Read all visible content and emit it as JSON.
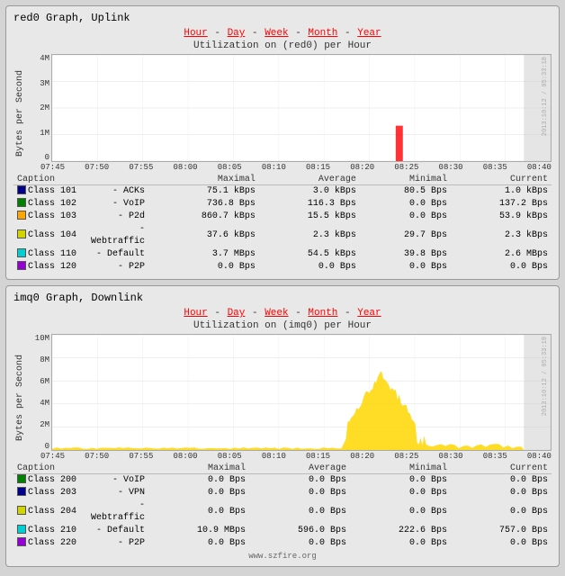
{
  "panels": [
    {
      "id": "uplink",
      "title": "red0 Graph, Uplink",
      "subtitle": "Utilization on (red0) per Hour",
      "navLinks": [
        "Hour",
        "Day",
        "Week",
        "Month",
        "Year"
      ],
      "yAxisLabel": "Bytes per Second",
      "yTicks": [
        "4M",
        "3M",
        "2M",
        "1M",
        "0"
      ],
      "xLabels": [
        "07:45",
        "07:50",
        "07:55",
        "08:00",
        "08:05",
        "08:10",
        "08:15",
        "08:20",
        "08:25",
        "08:30",
        "08:35",
        "08:40"
      ],
      "watermark": "2013:10:12 / 05:33:18",
      "peakX": 72,
      "peakColor": "red",
      "peakHeight": 40,
      "rightBarColor": "#ccc",
      "legend": {
        "headers": [
          "Caption",
          "",
          "Maximal",
          "Average",
          "Minimal",
          "Current"
        ],
        "rows": [
          {
            "color": "#00008b",
            "class": "Class 101",
            "name": "ACKs",
            "maximal": "75.1 kBps",
            "average": "3.0 kBps",
            "minimal": "80.5  Bps",
            "current": "1.0  kBps"
          },
          {
            "color": "#008000",
            "class": "Class 102",
            "name": "VoIP",
            "maximal": "736.8  Bps",
            "average": "116.3  Bps",
            "minimal": "0.0  Bps",
            "current": "137.2  Bps"
          },
          {
            "color": "#ffa500",
            "class": "Class 103",
            "name": "P2d",
            "maximal": "860.7 kBps",
            "average": "15.5 kBps",
            "minimal": "0.0  Bps",
            "current": "53.9 kBps"
          },
          {
            "color": "#d3d300",
            "class": "Class 104",
            "name": "Webtraffic",
            "maximal": "37.6 kBps",
            "average": "2.3 kBps",
            "minimal": "29.7  Bps",
            "current": "2.3 kBps"
          },
          {
            "color": "#00ced1",
            "class": "Class 110",
            "name": "Default",
            "maximal": "3.7  MBps",
            "average": "54.5 kBps",
            "minimal": "39.8  Bps",
            "current": "2.6  MBps"
          },
          {
            "color": "#9400d3",
            "class": "Class 120",
            "name": "P2P",
            "maximal": "0.0  Bps",
            "average": "0.0  Bps",
            "minimal": "0.0  Bps",
            "current": "0.0  Bps"
          }
        ]
      }
    },
    {
      "id": "downlink",
      "title": "imq0 Graph, Downlink",
      "subtitle": "Utilization on (imq0) per Hour",
      "navLinks": [
        "Hour",
        "Day",
        "Week",
        "Month",
        "Year"
      ],
      "yAxisLabel": "Bytes per Second",
      "yTicks": [
        "10M",
        "8M",
        "6M",
        "4M",
        "2M",
        "0"
      ],
      "xLabels": [
        "07:45",
        "07:50",
        "07:55",
        "08:00",
        "08:05",
        "08:10",
        "08:15",
        "08:20",
        "08:25",
        "08:30",
        "08:35",
        "08:40"
      ],
      "watermark": "2013:10:12 / 05:33:19",
      "peakX": 72,
      "peakColor": "#ffd700",
      "peakHeight": 80,
      "rightBarColor": "#ccc",
      "legend": {
        "headers": [
          "Caption",
          "",
          "Maximal",
          "Average",
          "Minimal",
          "Current"
        ],
        "rows": [
          {
            "color": "#008000",
            "class": "Class 200",
            "name": "VoIP",
            "maximal": "0.0  Bps",
            "average": "0.0  Bps",
            "minimal": "0.0  Bps",
            "current": "0.0  Bps"
          },
          {
            "color": "#00008b",
            "class": "Class 203",
            "name": "VPN",
            "maximal": "0.0  Bps",
            "average": "0.0  Bps",
            "minimal": "0.0  Bps",
            "current": "0.0  Bps"
          },
          {
            "color": "#d3d300",
            "class": "Class 204",
            "name": "Webtraffic",
            "maximal": "0.0  Bps",
            "average": "0.0  Bps",
            "minimal": "0.0  Bps",
            "current": "0.0  Bps"
          },
          {
            "color": "#00ced1",
            "class": "Class 210",
            "name": "Default",
            "maximal": "10.9  MBps",
            "average": "596.0  Bps",
            "minimal": "222.6  Bps",
            "current": "757.0  Bps"
          },
          {
            "color": "#9400d3",
            "class": "Class 220",
            "name": "P2P",
            "maximal": "0.0  Bps",
            "average": "0.0  Bps",
            "minimal": "0.0  Bps",
            "current": "0.0  Bps"
          }
        ]
      }
    }
  ],
  "footer": "www.szfire.org"
}
